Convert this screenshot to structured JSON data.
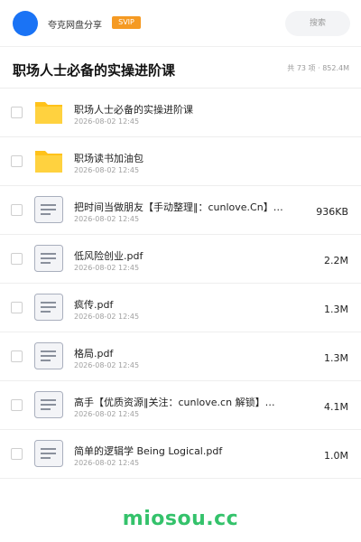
{
  "header": {
    "username": "夸克网盘分享",
    "badge": "SVIP",
    "search_placeholder": "搜索"
  },
  "folder": {
    "title": "职场人士必备的实操进阶课",
    "meta": "共 73 项 · 852.4M"
  },
  "items": [
    {
      "type": "folder",
      "name": "职场人士必备的实操进阶课",
      "date": "2026-08-02 12:45",
      "size": ""
    },
    {
      "type": "folder",
      "name": "职场读书加油包",
      "date": "2026-08-02 12:45",
      "size": ""
    },
    {
      "type": "file",
      "name": "把时间当做朋友【手动整理‖：cunlove.Cn】…",
      "date": "2026-08-02 12:45",
      "size": "936KB"
    },
    {
      "type": "file",
      "name": "低风险创业.pdf",
      "date": "2026-08-02 12:45",
      "size": "2.2M"
    },
    {
      "type": "file",
      "name": "疯传.pdf",
      "date": "2026-08-02 12:45",
      "size": "1.3M"
    },
    {
      "type": "file",
      "name": "格局.pdf",
      "date": "2026-08-02 12:45",
      "size": "1.3M"
    },
    {
      "type": "file",
      "name": "高手【优质资源‖关注：cunlove.cn 解锁】…",
      "date": "2026-08-02 12:45",
      "size": "4.1M"
    },
    {
      "type": "file",
      "name": "简单的逻辑学 Being Logical.pdf",
      "date": "2026-08-02 12:45",
      "size": "1.0M"
    }
  ],
  "footer": {
    "brand": "miosou.cc"
  },
  "colors": {
    "accent": "#1a73f5",
    "folder": "#ffc21a",
    "brand": "#34c26b",
    "badge": "#f59a23"
  }
}
